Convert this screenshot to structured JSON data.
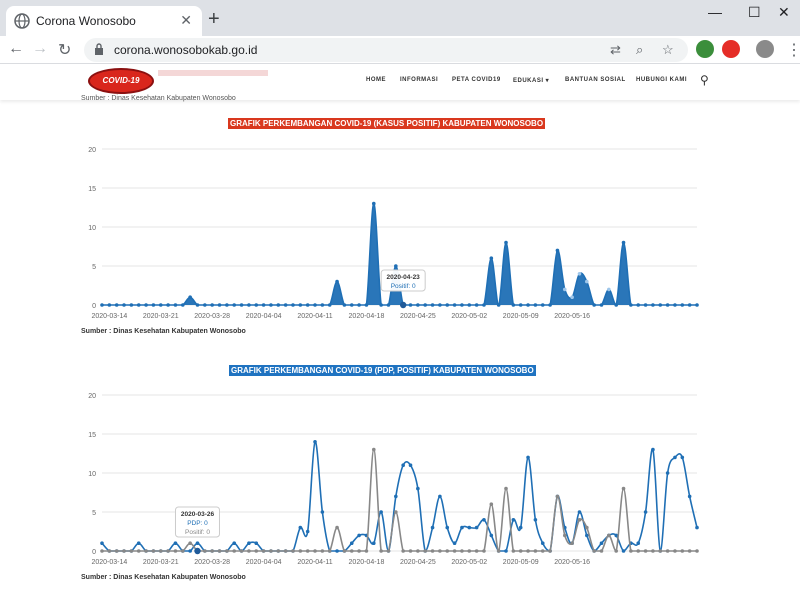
{
  "browser": {
    "tab_title": "Corona Wonosobo",
    "tab_close": "✕",
    "new_tab": "+",
    "url": "corona.wonosobokab.go.id",
    "window_controls": [
      "—",
      "☐",
      "✕"
    ]
  },
  "site": {
    "logo_text": "COVID-19",
    "menu": [
      "HOME",
      "INFORMASI",
      "PETA COVID19",
      "EDUKASI ▾",
      "BANTUAN SOSIAL",
      "HUBUNGI KAMI"
    ],
    "cut_source": "Sumber : Dinas Kesehatan Kabupaten Wonosobo"
  },
  "chart_data": [
    {
      "type": "area",
      "title": "GRAFIK PERKEMBANGAN COVID-19 (KASUS POSITIF) KABUPATEN WONOSOBO",
      "title_color": "#d9381e",
      "source": "Sumber : Dinas Kesehatan Kabupaten Wonosobo",
      "ylim": [
        0,
        20
      ],
      "yticks": [
        0,
        5,
        10,
        15,
        20
      ],
      "x_start": "2020-03-13",
      "xticks": [
        "2020-03-14",
        "2020-03-21",
        "2020-03-28",
        "2020-04-04",
        "2020-04-11",
        "2020-04-18",
        "2020-04-25",
        "2020-05-02",
        "2020-05-09",
        "2020-05-16"
      ],
      "series": [
        {
          "name": "Positif",
          "color": "#1f6fb5",
          "values": [
            0,
            0,
            0,
            0,
            0,
            0,
            0,
            0,
            0,
            0,
            0,
            0,
            1,
            0,
            0,
            0,
            0,
            0,
            0,
            0,
            0,
            0,
            0,
            0,
            0,
            0,
            0,
            0,
            0,
            0,
            0,
            0,
            3,
            0,
            0,
            0,
            0,
            13,
            0,
            0,
            5,
            0,
            0,
            0,
            0,
            0,
            0,
            0,
            0,
            0,
            0,
            0,
            0,
            6,
            0,
            8,
            0,
            0,
            0,
            0,
            0,
            0,
            7,
            2,
            1,
            4,
            3,
            0,
            0,
            2,
            0,
            8,
            0,
            0,
            0,
            0,
            0,
            0,
            0,
            0,
            0,
            0
          ]
        }
      ],
      "tooltip": {
        "date": "2020-04-23",
        "label": "Positif: 0"
      }
    },
    {
      "type": "line",
      "title": "GRAFIK PERKEMBANGAN COVID-19 (PDP, POSITIF) KABUPATEN WONOSOBO",
      "title_color": "#1f73c1",
      "source": "Sumber : Dinas Kesehatan Kabupaten Wonosobo",
      "ylim": [
        0,
        20
      ],
      "yticks": [
        0,
        5,
        10,
        15,
        20
      ],
      "x_start": "2020-03-13",
      "xticks": [
        "2020-03-14",
        "2020-03-21",
        "2020-03-28",
        "2020-04-04",
        "2020-04-11",
        "2020-04-18",
        "2020-04-25",
        "2020-05-02",
        "2020-05-09",
        "2020-05-16"
      ],
      "series": [
        {
          "name": "PDP",
          "color": "#1f6fb5",
          "values": [
            1,
            0,
            0,
            0,
            0,
            1,
            0,
            0,
            0,
            0,
            1,
            0,
            0,
            1,
            0,
            0,
            0,
            0,
            1,
            0,
            1,
            1,
            0,
            0,
            0,
            0,
            0,
            3,
            2.5,
            14,
            5,
            0,
            0,
            0,
            1,
            2,
            2,
            1,
            5,
            0,
            7,
            11,
            11,
            8,
            0,
            3,
            7,
            3,
            1,
            3,
            3,
            3,
            4,
            2,
            0,
            0,
            4,
            3,
            12,
            4,
            1,
            0,
            7,
            3,
            1,
            5,
            2,
            0,
            1,
            2,
            2,
            0,
            1,
            1,
            5,
            13,
            0,
            10,
            12,
            12,
            7,
            3
          ]
        },
        {
          "name": "Positif",
          "color": "#888888",
          "values": [
            0,
            0,
            0,
            0,
            0,
            0,
            0,
            0,
            0,
            0,
            0,
            0,
            1,
            0,
            0,
            0,
            0,
            0,
            0,
            0,
            0,
            0,
            0,
            0,
            0,
            0,
            0,
            0,
            0,
            0,
            0,
            0,
            3,
            0,
            0,
            0,
            0,
            13,
            0,
            0,
            5,
            0,
            0,
            0,
            0,
            0,
            0,
            0,
            0,
            0,
            0,
            0,
            0,
            6,
            0,
            8,
            0,
            0,
            0,
            0,
            0,
            0,
            7,
            2,
            1,
            4,
            3,
            0,
            0,
            2,
            0,
            8,
            0,
            0,
            0,
            0,
            0,
            0,
            0,
            0,
            0,
            0
          ]
        }
      ],
      "tooltip": {
        "date": "2020-03-26",
        "lines": [
          "PDP: 0",
          "Positif: 0"
        ]
      }
    }
  ]
}
